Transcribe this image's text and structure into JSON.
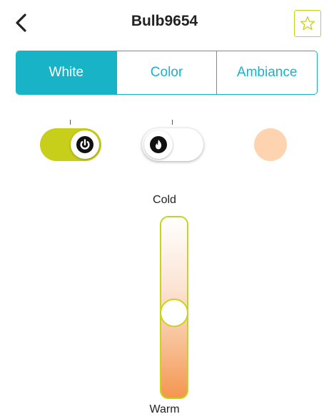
{
  "header": {
    "title": "Bulb9654",
    "back_icon": "chevron-left-icon",
    "favorite_icon": "star-outline-icon"
  },
  "tabs": [
    {
      "label": "White",
      "active": true
    },
    {
      "label": "Color",
      "active": false
    },
    {
      "label": "Ambiance",
      "active": false
    }
  ],
  "controls": {
    "power_toggle": {
      "icon": "power-icon",
      "on": true
    },
    "flame_toggle": {
      "icon": "flame-icon",
      "on": false
    },
    "color_swatch": {
      "color": "#fdd3b0"
    }
  },
  "temperature_slider": {
    "top_label": "Cold",
    "bottom_label": "Warm",
    "value": 0.53
  },
  "colors": {
    "accent": "#19b3c7",
    "toggle_on": "#c8cf1a",
    "slider_border": "#c8d41a",
    "warm_end": "#f4964f"
  }
}
